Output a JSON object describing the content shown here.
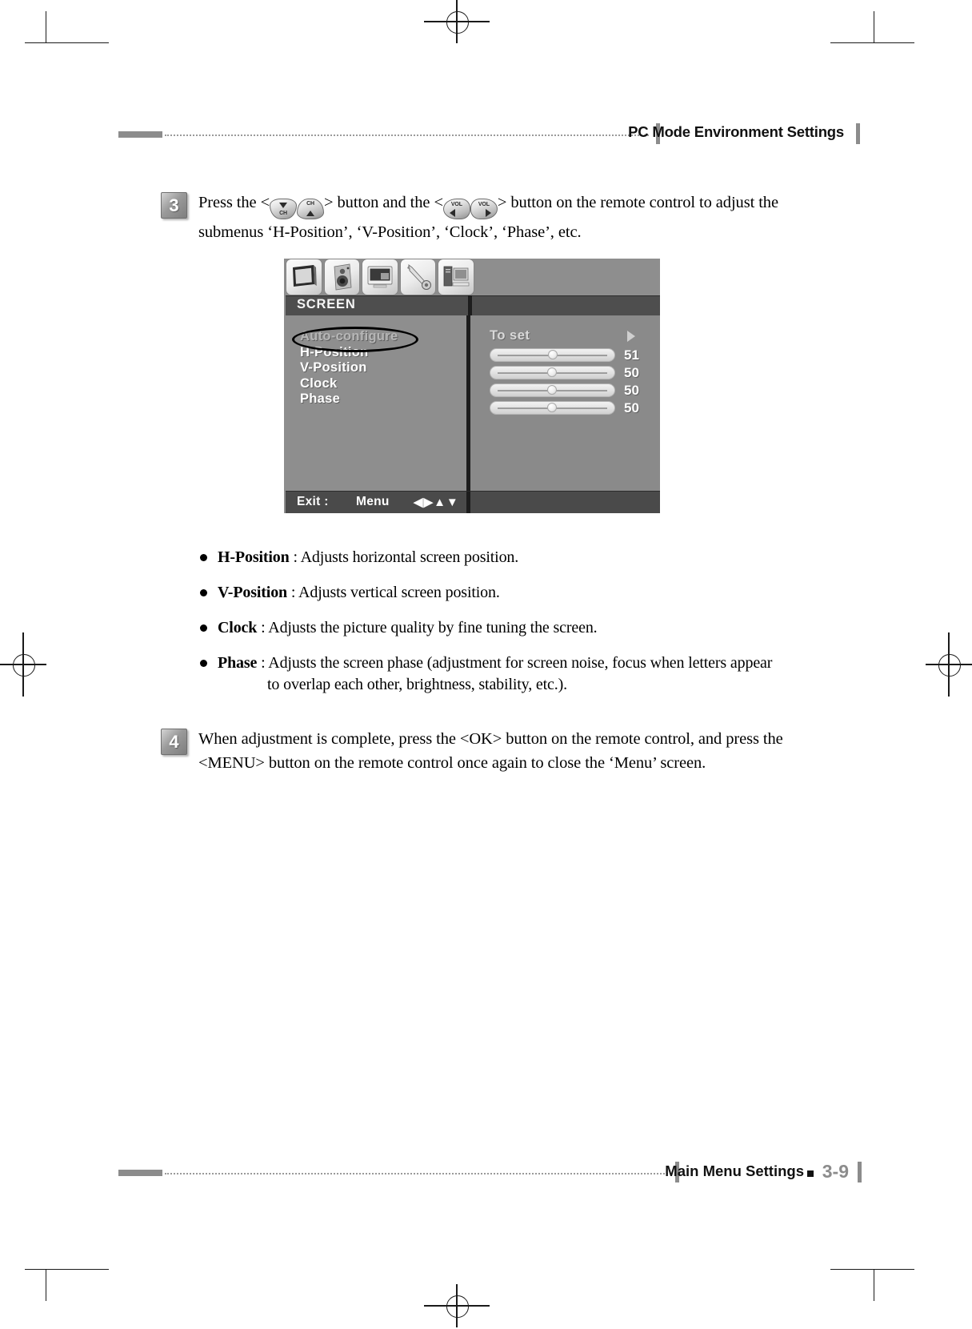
{
  "page": {
    "header_title": "PC Mode Environment Settings",
    "footer_title": "Main Menu Settings",
    "footer_page": "3-9"
  },
  "steps": [
    {
      "number": "3",
      "text_a": "Press the <",
      "text_b": "> button and the <",
      "text_c": "> button on the remote control to adjust the",
      "text_d": "submenus ‘H-Position’, ‘V-Position’, ‘Clock’, ‘Phase’, etc.",
      "keys": [
        {
          "name": "ch-down",
          "label": "CH"
        },
        {
          "name": "ch-up",
          "label": "CH"
        },
        {
          "name": "vol-down",
          "label": "VOL"
        },
        {
          "name": "vol-up",
          "label": "VOL"
        }
      ]
    },
    {
      "number": "4",
      "line1": "When adjustment is complete, press the <OK> button on the remote control, and press the",
      "line2": "<MENU> button on the remote control once again to close the ‘Menu’ screen."
    }
  ],
  "osd": {
    "icons": [
      {
        "name": "picture-tv-icon"
      },
      {
        "name": "sound-speaker-icon"
      },
      {
        "name": "screen-monitor-icon"
      },
      {
        "name": "setup-wrench-icon"
      },
      {
        "name": "pc-computer-icon"
      }
    ],
    "title": "SCREEN",
    "menu_items": [
      {
        "label": "Auto-configure",
        "highlighted": true
      },
      {
        "label": "H-Position",
        "highlighted": false
      },
      {
        "label": "V-Position",
        "highlighted": false
      },
      {
        "label": "Clock",
        "highlighted": false
      },
      {
        "label": "Phase",
        "highlighted": false
      }
    ],
    "right_header": "To set",
    "right_header_arrow": "▶",
    "sliders": [
      {
        "value": "51",
        "percent": 51
      },
      {
        "value": "50",
        "percent": 50
      },
      {
        "value": "50",
        "percent": 50
      },
      {
        "value": "50",
        "percent": 50
      }
    ],
    "footer": {
      "exit_label": "Exit :",
      "menu_label": "Menu",
      "arrows": "◀▶▲▼"
    }
  },
  "bullets": [
    {
      "term": "H-Position",
      "sep": " : ",
      "desc": "Adjusts horizontal screen position.",
      "cont": ""
    },
    {
      "term": "V-Position",
      "sep": " : ",
      "desc": "Adjusts vertical screen position.",
      "cont": ""
    },
    {
      "term": "Clock",
      "sep": " : ",
      "desc": "Adjusts the picture quality by fine tuning the screen.",
      "cont": ""
    },
    {
      "term": "Phase",
      "sep": " : ",
      "desc": "Adjusts the screen phase (adjustment for screen noise, focus when letters appear",
      "cont": "to overlap each other, brightness, stability, etc.)."
    }
  ]
}
